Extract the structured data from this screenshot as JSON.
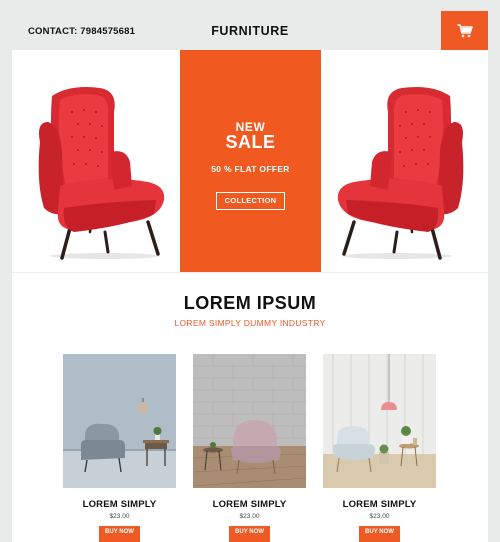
{
  "header": {
    "contact": "CONTACT: 7984575681",
    "brand": "FURNITURE"
  },
  "hero": {
    "new": "NEW",
    "sale": "SALE",
    "offer": "50 % FLAT OFFER",
    "button": "COLLECTION"
  },
  "section": {
    "title": "LOREM IPSUM",
    "subtitle": "LOREM SIMPLY DUMMY INDUSTRY"
  },
  "products": [
    {
      "name": "LOREM SIMPLY",
      "price": "$23.00",
      "button": "BUY NOW"
    },
    {
      "name": "LOREM SIMPLY",
      "price": "$23.00",
      "button": "BUY NOW"
    },
    {
      "name": "LOREM SIMPLY",
      "price": "$23.00",
      "button": "BUY NOW"
    }
  ],
  "colors": {
    "accent": "#ef5a24",
    "chair": "#e8353b",
    "page_bg": "#e9eaea"
  },
  "icons": {
    "cart": "shopping-cart-icon"
  }
}
